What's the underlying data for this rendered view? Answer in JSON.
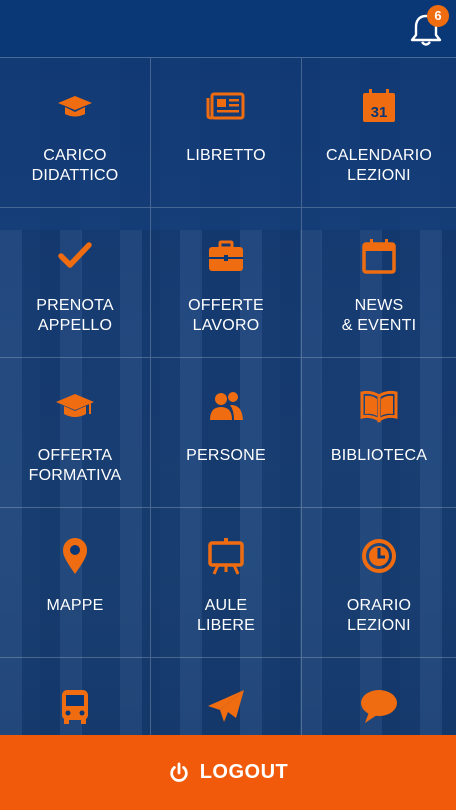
{
  "colors": {
    "accent": "#f05a0a",
    "header": "#0a3775",
    "icon": "#f06c10"
  },
  "notifications": {
    "count": "6",
    "icon": "bell-icon"
  },
  "tiles": [
    {
      "label": "CARICO\nDIDATTICO",
      "icon": "graduation-cap-icon"
    },
    {
      "label": "LIBRETTO",
      "icon": "newspaper-icon"
    },
    {
      "label": "CALENDARIO\nLEZIONI",
      "icon": "calendar-31-icon"
    },
    {
      "label": "PRENOTA\nAPPELLO",
      "icon": "checkmark-icon"
    },
    {
      "label": "OFFERTE\nLAVORO",
      "icon": "briefcase-icon"
    },
    {
      "label": "NEWS\n& EVENTI",
      "icon": "calendar-icon"
    },
    {
      "label": "OFFERTA\nFORMATIVA",
      "icon": "mortarboard-icon"
    },
    {
      "label": "PERSONE",
      "icon": "people-icon"
    },
    {
      "label": "BIBLIOTECA",
      "icon": "open-book-icon"
    },
    {
      "label": "MAPPE",
      "icon": "map-pin-icon"
    },
    {
      "label": "AULE\nLIBERE",
      "icon": "easel-icon"
    },
    {
      "label": "ORARIO\nLEZIONI",
      "icon": "clock-icon"
    },
    {
      "label": "",
      "icon": "bus-icon"
    },
    {
      "label": "",
      "icon": "paper-plane-icon"
    },
    {
      "label": "",
      "icon": "chat-bubble-icon"
    }
  ],
  "logout": {
    "label": "LOGOUT",
    "icon": "power-icon"
  }
}
